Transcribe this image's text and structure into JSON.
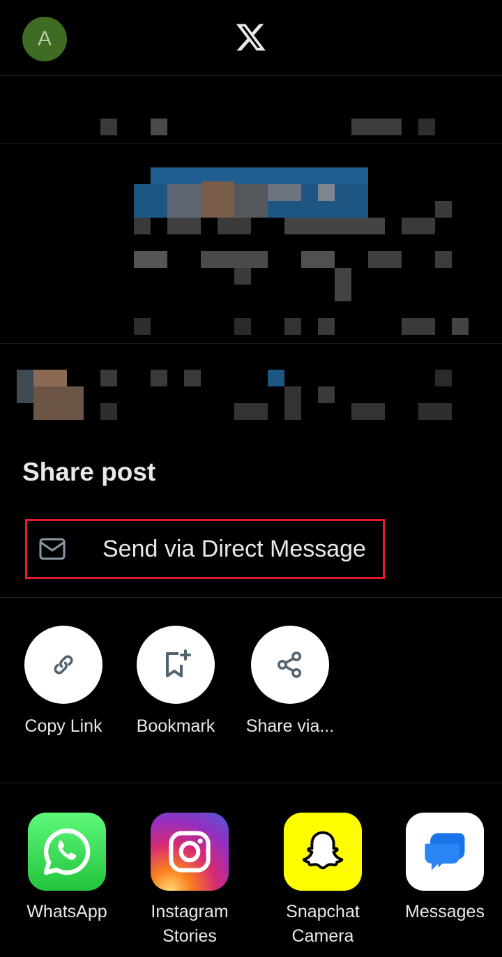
{
  "header": {
    "avatar_initial": "A",
    "logo": "x-logo-icon"
  },
  "share_sheet": {
    "title": "Share post",
    "direct_message": {
      "label": "Send via Direct Message",
      "icon": "envelope-icon"
    },
    "actions": [
      {
        "label": "Copy Link",
        "icon": "link-icon"
      },
      {
        "label": "Bookmark",
        "icon": "bookmark-add-icon"
      },
      {
        "label": "Share via...",
        "icon": "share-icon"
      }
    ],
    "apps": [
      {
        "label": "WhatsApp",
        "icon": "whatsapp-icon"
      },
      {
        "label": "Instagram Stories",
        "icon": "instagram-icon"
      },
      {
        "label": "Snapchat Camera",
        "icon": "snapchat-icon"
      },
      {
        "label": "Messages",
        "icon": "messages-icon"
      }
    ]
  },
  "colors": {
    "background": "#000000",
    "highlight_border": "#e21b2c",
    "avatar": "#3f6b22",
    "icon_gray": "#536471"
  }
}
